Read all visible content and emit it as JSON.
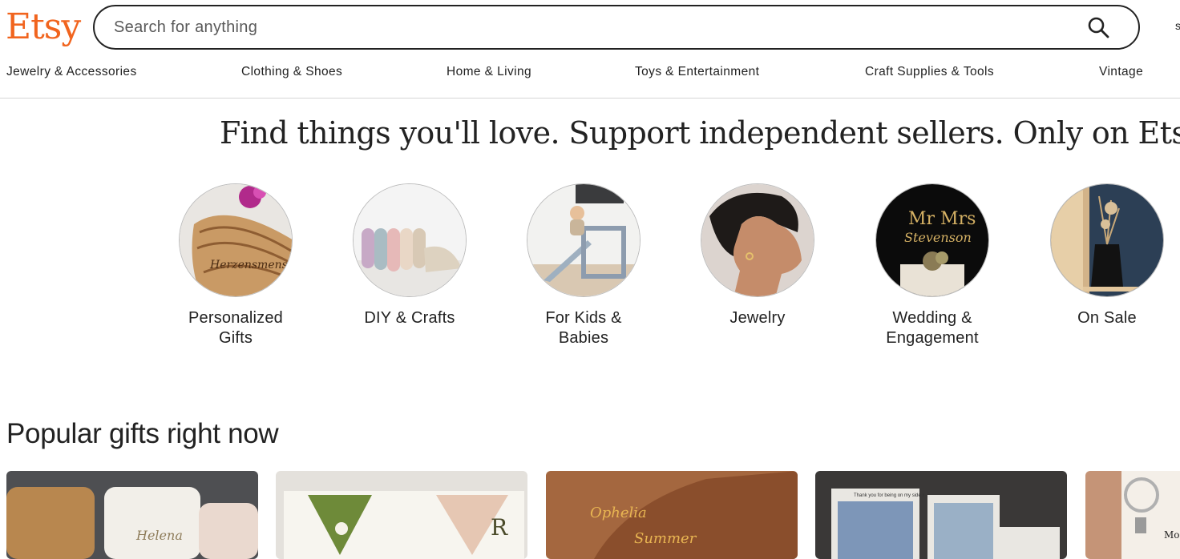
{
  "header": {
    "logo": "Etsy",
    "search_placeholder": "Search for anything",
    "edge_text": "s"
  },
  "nav": [
    "Jewelry & Accessories",
    "Clothing & Shoes",
    "Home & Living",
    "Toys & Entertainment",
    "Craft Supplies & Tools",
    "Vintage"
  ],
  "hero": {
    "headline": "Find things you'll love. Support independent sellers. Only on Etsy."
  },
  "categories": [
    {
      "label": "Personalized Gifts",
      "image": "engraved-wood-board"
    },
    {
      "label": "DIY & Crafts",
      "image": "fabric-rolls"
    },
    {
      "label": "For Kids & Babies",
      "image": "child-on-climbing-slide"
    },
    {
      "label": "Jewelry",
      "image": "woman-with-earring"
    },
    {
      "label": "Wedding & Engagement",
      "image": "mr-mrs-cake-topper"
    },
    {
      "label": "On Sale",
      "image": "dried-flower-vase"
    }
  ],
  "popular": {
    "title": "Popular gifts right now",
    "cards": [
      {
        "image": "personalized-jewelry-boxes",
        "text": "Helena"
      },
      {
        "image": "embroidered-corner-bookmarks",
        "text": "R"
      },
      {
        "image": "name-necklaces",
        "text1": "Ophelia",
        "text2": "Summer"
      },
      {
        "image": "acrylic-photo-plaques",
        "text": "Thank you for being on my side x"
      },
      {
        "image": "keychain-ring",
        "text": "Mo and"
      }
    ]
  },
  "colors": {
    "brand": "#f1641e",
    "text": "#222222",
    "divider": "#d6d6d6"
  }
}
